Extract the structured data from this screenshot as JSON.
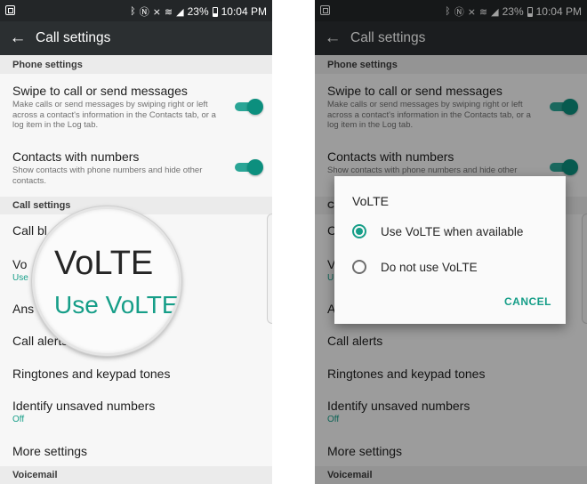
{
  "status_bar": {
    "icons": [
      "bluetooth-icon",
      "nfc-icon",
      "mute-icon",
      "wifi-icon",
      "signal-icon",
      "battery-icon"
    ],
    "battery": "23%",
    "time": "10:04 PM"
  },
  "app_bar": {
    "title": "Call settings"
  },
  "sections": {
    "phone_settings": "Phone settings",
    "call_settings": "Call settings",
    "voicemail": "Voicemail"
  },
  "left": {
    "swipe": {
      "title": "Swipe to call or send messages",
      "desc": "Make calls or send messages by swiping right or left across a contact's information in the Contacts tab, or a log item in the Log tab."
    },
    "contacts": {
      "title": "Contacts with numbers",
      "desc": "Show contacts with phone numbers and hide other contacts."
    },
    "call_blocking_partial": "Call bl",
    "volte_partial": "Vo",
    "volte_value_partial": "Use",
    "answer_partial": "Ans",
    "call_alerts": "Call alerts",
    "ringtones": "Ringtones and keypad tones",
    "identify": {
      "title": "Identify unsaved numbers",
      "value": "Off"
    },
    "more": "More settings",
    "magnifier": {
      "title": "VoLTE",
      "value": "Use VoLTE"
    }
  },
  "right": {
    "swipe": {
      "title": "Swipe to call or send messages",
      "desc": "Make calls or send messages by swiping right or left across a contact's information in the Contacts tab, or a log item in the Log tab."
    },
    "contacts": {
      "title": "Contacts with numbers",
      "desc": "Show contacts with phone numbers and hide other"
    },
    "section_partial": "Ca",
    "call_blocking_partial": "C",
    "volte_partial": "V",
    "volte_value_partial": "U",
    "answer_partial": "A",
    "call_alerts": "Call alerts",
    "ringtones": "Ringtones and keypad tones",
    "identify": {
      "title": "Identify unsaved numbers",
      "value": "Off"
    },
    "more": "More settings"
  },
  "dialog": {
    "title": "VoLTE",
    "options": [
      "Use VoLTE when available",
      "Do not use VoLTE"
    ],
    "selected": "Use VoLTE when available",
    "cancel": "CANCEL"
  },
  "colors": {
    "accent": "#169e88",
    "status_bar": "#232628",
    "app_bar": "#2b2f31",
    "section_header": "#ebebeb",
    "background": "#f7f7f7"
  }
}
